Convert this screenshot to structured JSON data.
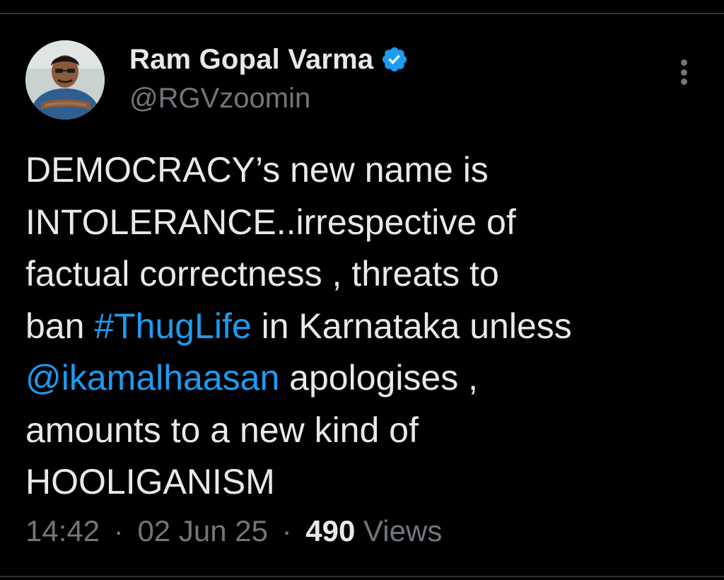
{
  "author": {
    "name": "Ram Gopal Varma",
    "handle": "@RGVzoomin",
    "verified": true
  },
  "tweet": {
    "lines": [
      [
        {
          "text": "DEMOCRACY’s new name is"
        }
      ],
      [
        {
          "text": "INTOLERANCE..irrespective of"
        }
      ],
      [
        {
          "text": "factual correctness , threats to"
        }
      ],
      [
        {
          "text": "ban "
        },
        {
          "text": "#ThugLife",
          "link": true
        },
        {
          "text": " in Karnataka unless"
        }
      ],
      [
        {
          "text": "@ikamalhaasan",
          "link": true
        },
        {
          "text": " apologises ,"
        }
      ],
      [
        {
          "text": "amounts to a new kind of"
        }
      ],
      [
        {
          "text": "HOOLIGANISM"
        }
      ]
    ]
  },
  "meta": {
    "time": "14:42",
    "date": "02 Jun 25",
    "separator": "·",
    "views_count": "490",
    "views_label": " Views"
  },
  "icons": {
    "verified": "verified-badge-icon",
    "more": "more-options-icon"
  },
  "colors": {
    "background": "#000000",
    "text": "#e7e9ea",
    "muted": "#71767b",
    "link": "#1d9bf0",
    "divider": "#2f3336"
  }
}
